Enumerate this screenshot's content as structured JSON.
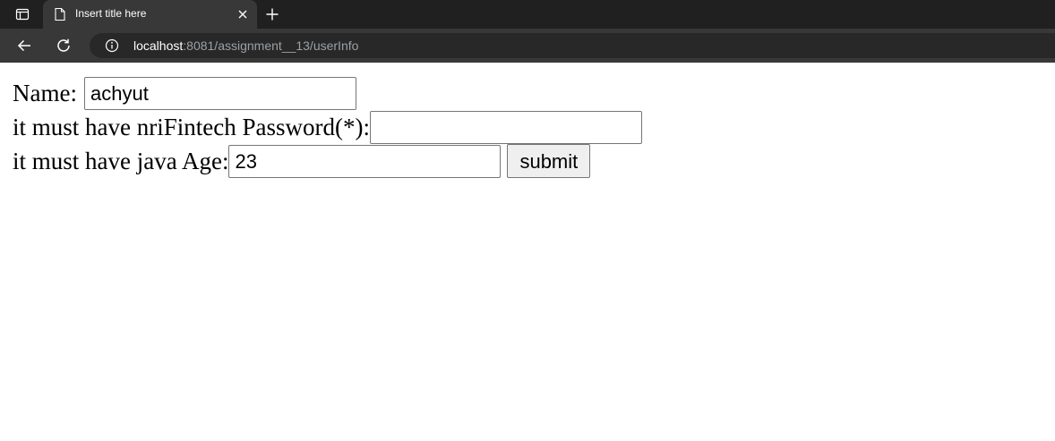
{
  "browser": {
    "tab_title": "Insert title here",
    "url_host": "localhost",
    "url_path": ":8081/assignment__13/userInfo",
    "icons": {
      "tab_actions": "tab-actions-icon",
      "page": "page-icon",
      "close": "close-icon",
      "new_tab": "plus-icon",
      "back": "back-arrow-icon",
      "reload": "reload-icon",
      "site_info": "info-icon"
    }
  },
  "form": {
    "name_label": "Name:",
    "name_value": "achyut",
    "password_label": "it must have nriFintech Password(*):",
    "password_value": "",
    "age_label": "it must have java Age:",
    "age_value": "23",
    "submit_label": "submit"
  }
}
